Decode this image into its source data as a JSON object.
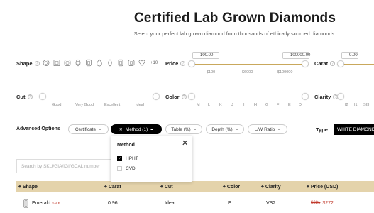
{
  "page": {
    "title": "Certified Lab Grown Diamonds",
    "subtitle": "Select your perfect lab grown diamond from thousands of ethically sourced diamonds."
  },
  "filters": {
    "shape": {
      "label": "Shape",
      "help": "?",
      "icons": [
        "round-icon",
        "princess-icon",
        "cushion-icon",
        "oval-icon",
        "radiant-icon",
        "pear-icon",
        "marquise-icon",
        "emerald-icon",
        "asscher-icon",
        "heart-icon"
      ],
      "more_label": "+10"
    },
    "price": {
      "label": "Price",
      "help": "?",
      "min_value": "100.00",
      "max_value": "100000.00",
      "ticks": [
        "$100",
        "$6000",
        "$100000"
      ]
    },
    "carat": {
      "label": "Carat",
      "help": "?",
      "min_value": "0.00"
    },
    "cut": {
      "label": "Cut",
      "help": "?",
      "ticks": [
        "Good",
        "Very Good",
        "Excellent",
        "Ideal"
      ]
    },
    "color": {
      "label": "Color",
      "help": "?",
      "ticks": [
        "M",
        "L",
        "K",
        "J",
        "I",
        "H",
        "G",
        "F",
        "E",
        "D"
      ]
    },
    "clarity": {
      "label": "Clarity",
      "help": "?",
      "ticks": [
        "I2",
        "I1",
        "SI3"
      ]
    }
  },
  "advanced": {
    "label": "Advanced Options",
    "pills": {
      "certificate": "Certificate",
      "method": "Method (1)",
      "method_clear": "✕",
      "table": "Table (%)",
      "depth": "Depth (%)",
      "lw_ratio": "L/W Ratio"
    }
  },
  "type": {
    "label": "Type",
    "value": "WHITE DIAMONDS"
  },
  "method_popup": {
    "title": "Method",
    "close": "✕",
    "options": [
      {
        "label": "HPHT",
        "checked": true,
        "mark": "✓"
      },
      {
        "label": "CVD",
        "checked": false,
        "mark": ""
      }
    ]
  },
  "search": {
    "placeholder": "Search by SKU/GIA/IGI/GCAL number"
  },
  "table": {
    "sort_glyph": "◆",
    "headers": [
      "Shape",
      "Carat",
      "Cut",
      "Color",
      "Clarity",
      "Price (USD)"
    ],
    "rows": [
      {
        "shape": "Emerald",
        "badge": "SALE",
        "carat": "0.96",
        "cut": "Ideal",
        "color": "E",
        "clarity": "VS2",
        "old_price": "$381",
        "price": "$272"
      }
    ]
  },
  "colors": {
    "accent": "#c9a85c",
    "table_header": "#e4d3ab",
    "sale": "#c0392b",
    "active_pill": "#000000"
  }
}
